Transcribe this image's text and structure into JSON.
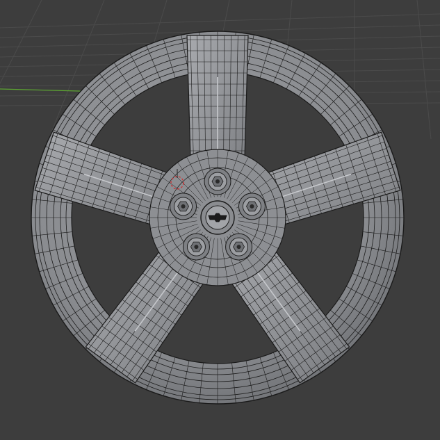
{
  "viewport": {
    "mode": "edit-mode-wireframe",
    "object": "five-spoke-wheel-mesh",
    "spoke_count": 5,
    "lug_nut_count": 5
  },
  "colors": {
    "background": "#3d3d3d",
    "grid_line": "#4b4b4b",
    "x_axis": "#5da632",
    "mesh_face": "#8d8f93",
    "mesh_face_light": "#b7b9bd",
    "mesh_face_dark": "#5c5f63",
    "wire": "#1a1a1a",
    "cursor_red": "#d42a2a"
  }
}
